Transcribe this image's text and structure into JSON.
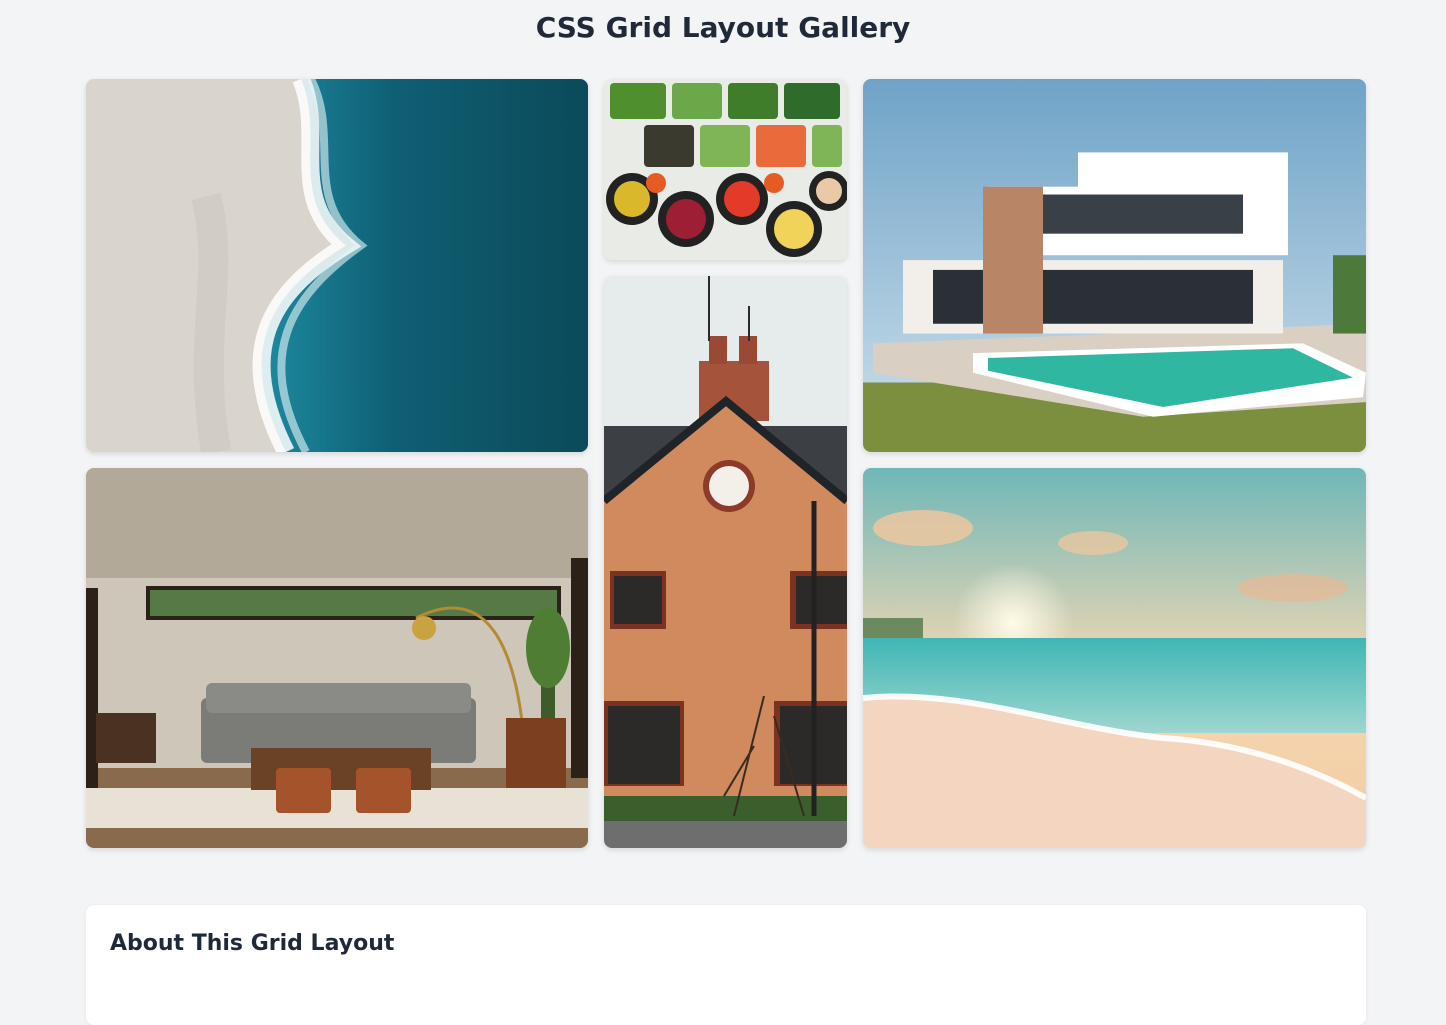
{
  "header": {
    "title": "CSS Grid Layout Gallery"
  },
  "gallery": {
    "items": [
      {
        "subject": "aerial ocean shoreline",
        "icon": "image-icon"
      },
      {
        "subject": "vegetable salad bowls",
        "icon": "image-icon"
      },
      {
        "subject": "modern villa with pool",
        "icon": "image-icon"
      },
      {
        "subject": "living room interior",
        "icon": "image-icon"
      },
      {
        "subject": "brick house with chimneys",
        "icon": "image-icon"
      },
      {
        "subject": "beach sunset",
        "icon": "image-icon"
      }
    ]
  },
  "about": {
    "title": "About This Grid Layout"
  },
  "colors": {
    "background": "#f3f4f6",
    "card": "#ffffff",
    "text": "#1f2937"
  }
}
